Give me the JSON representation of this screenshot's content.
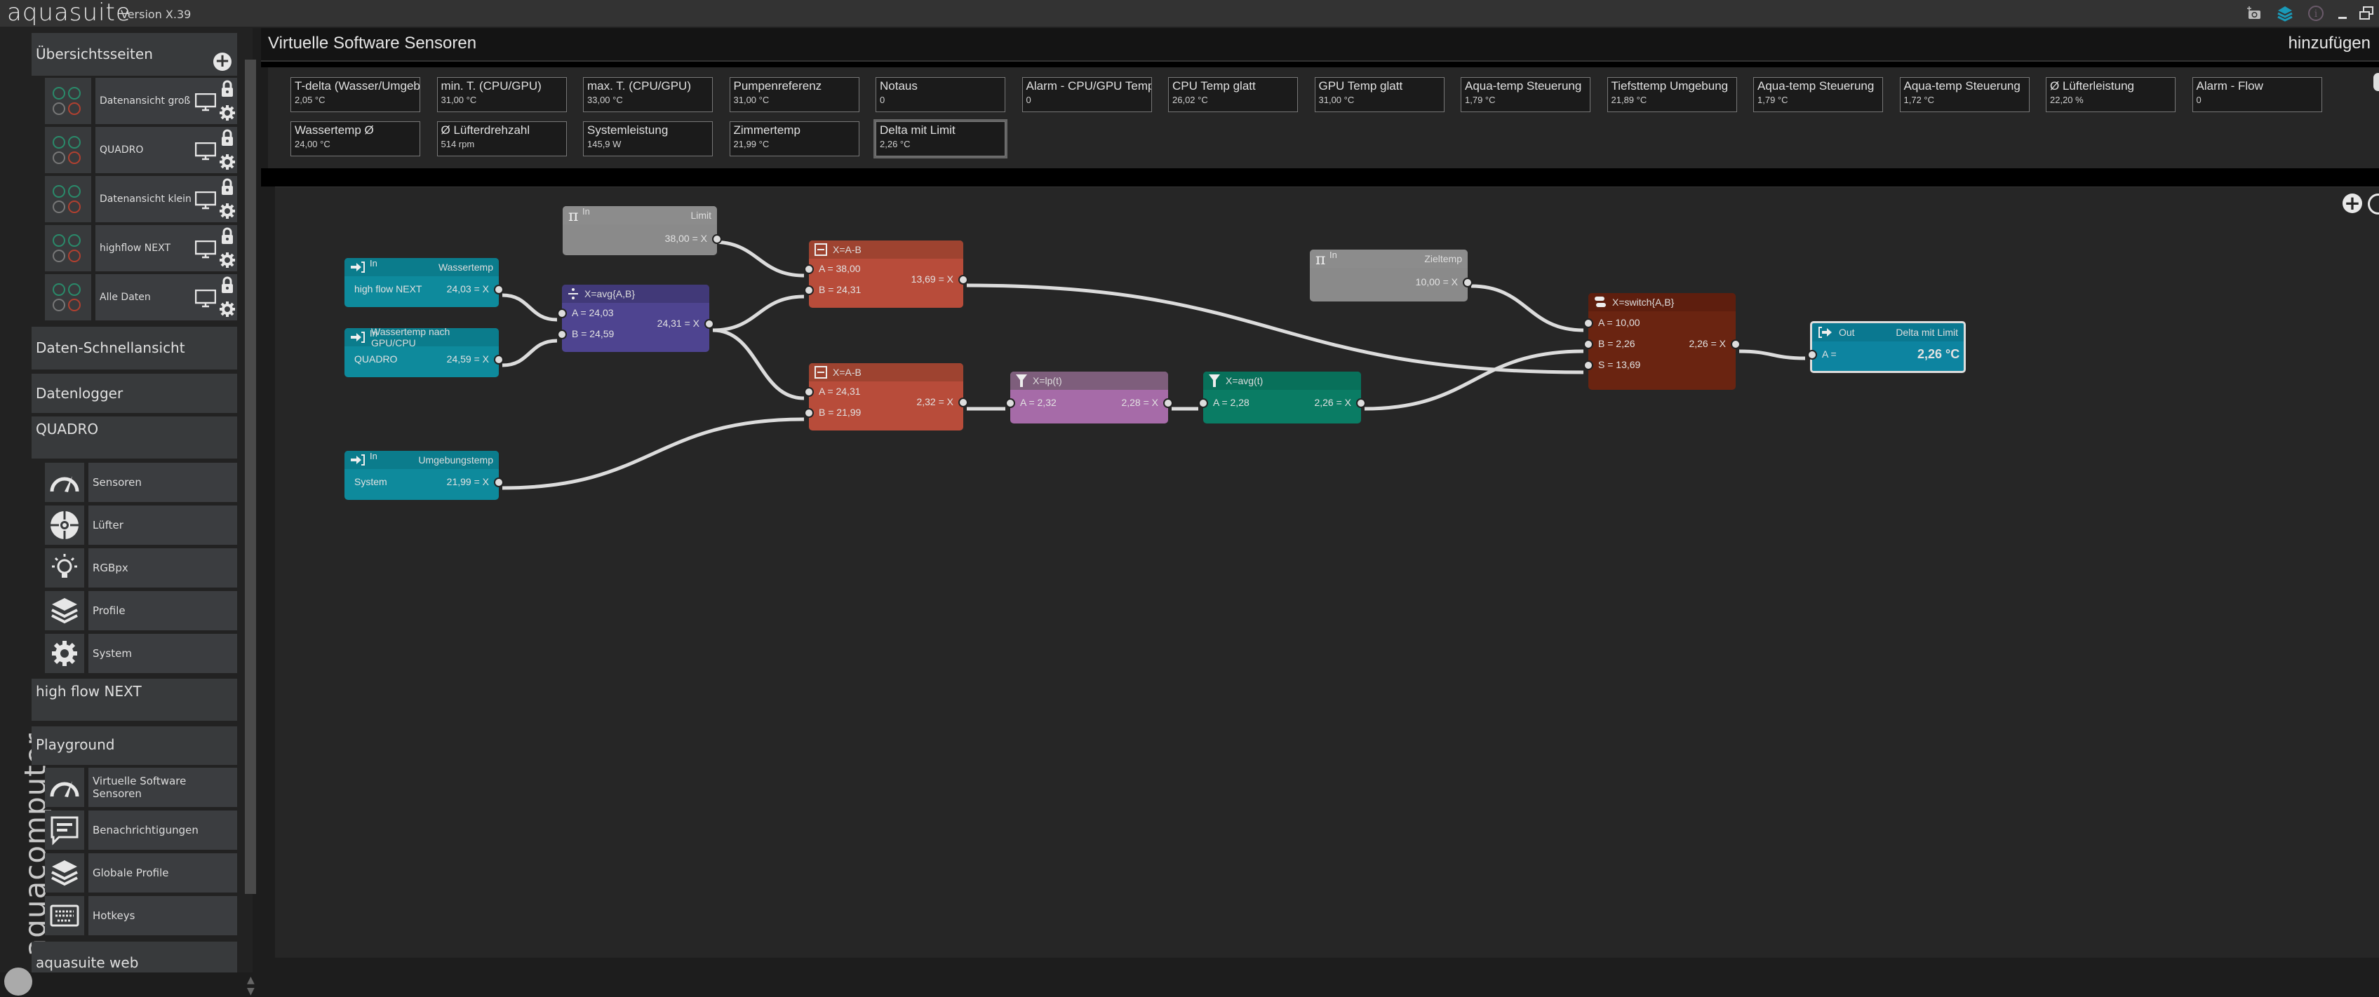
{
  "app": {
    "name": "aquasuite",
    "version": "Version X.39"
  },
  "window_controls": [
    {
      "name": "screenshot-icon"
    },
    {
      "name": "layers-icon"
    },
    {
      "name": "info-icon"
    },
    {
      "name": "minimize-icon"
    },
    {
      "name": "restore-icon"
    }
  ],
  "sidebar": {
    "overview_section": "Übersichtsseiten",
    "overview_pages": [
      {
        "label": "Datenansicht groß"
      },
      {
        "label": "QUADRO"
      },
      {
        "label": "Datenansicht klein"
      },
      {
        "label": "highflow NEXT"
      },
      {
        "label": "Alle Daten"
      }
    ],
    "quick_view": "Daten-Schnellansicht",
    "datalogger": "Datenlogger",
    "quadro_section": "QUADRO",
    "quadro_items": [
      {
        "label": "Sensoren",
        "icon": "gauge-icon"
      },
      {
        "label": "Lüfter",
        "icon": "fan-icon"
      },
      {
        "label": "RGBpx",
        "icon": "lightbulb-icon"
      },
      {
        "label": "Profile",
        "icon": "layers-icon"
      },
      {
        "label": "System",
        "icon": "gear-icon"
      }
    ],
    "highflow_section": "high flow NEXT",
    "playground_section": "Playground",
    "playground_items": [
      {
        "label": "Virtuelle Software Sensoren",
        "icon": "gauge-icon"
      },
      {
        "label": "Benachrichtigungen",
        "icon": "message-icon"
      },
      {
        "label": "Globale Profile",
        "icon": "layers-icon"
      },
      {
        "label": "Hotkeys",
        "icon": "keyboard-icon"
      }
    ],
    "web_section": "aquasuite web",
    "brand_vertical": "aquacomputer"
  },
  "header": {
    "title": "Virtuelle Software Sensoren",
    "add_label": "hinzufügen"
  },
  "tiles": [
    {
      "name": "T-delta (Wasser/Umgebung)",
      "value": "2,05 °C"
    },
    {
      "name": "min. T. (CPU/GPU)",
      "value": "31,00 °C"
    },
    {
      "name": "max. T. (CPU/GPU)",
      "value": "33,00 °C"
    },
    {
      "name": "Pumpenreferenz",
      "value": "31,00 °C"
    },
    {
      "name": "Notaus",
      "value": "0"
    },
    {
      "name": "Alarm - CPU/GPU Temp",
      "value": "0"
    },
    {
      "name": "CPU Temp glatt",
      "value": "26,02 °C"
    },
    {
      "name": "GPU Temp glatt",
      "value": "31,00 °C"
    },
    {
      "name": "Aqua-temp Steuerung",
      "value": "1,79 °C"
    },
    {
      "name": "Tiefsttemp Umgebung",
      "value": "21,89 °C"
    },
    {
      "name": "Aqua-temp Steuerung",
      "value": "1,79 °C"
    },
    {
      "name": "Aqua-temp Steuerung",
      "value": "1,72 °C"
    },
    {
      "name": "Ø Lüfterleistung",
      "value": "22,20 %"
    },
    {
      "name": "Alarm - Flow",
      "value": "0"
    },
    {
      "name": "Wassertemp Ø",
      "value": "24,00 °C"
    },
    {
      "name": "Ø Lüfterdrehzahl",
      "value": "514 rpm"
    },
    {
      "name": "Systemleistung",
      "value": "145,9 W"
    },
    {
      "name": "Zimmertemp",
      "value": "21,99 °C"
    },
    {
      "name": "Delta mit Limit",
      "value": "2,26 °C",
      "selected": true
    }
  ],
  "nodes": {
    "limit": {
      "type": "In",
      "name": "Limit",
      "out": "38,00 = X"
    },
    "wassertemp": {
      "type": "In",
      "name": "Wassertemp",
      "source": "high flow NEXT",
      "out": "24,03 = X"
    },
    "wassertemp_gpu": {
      "type": "In",
      "name": "Wassertemp nach GPU/CPU",
      "source": "QUADRO",
      "out": "24,59 = X"
    },
    "avg": {
      "formula": "X=avg{A,B}",
      "a": "A = 24,03",
      "b": "B = 24,59",
      "out": "24,31 = X"
    },
    "sub1": {
      "formula": "X=A-B",
      "a": "A = 38,00",
      "b": "B = 24,31",
      "out": "13,69 = X"
    },
    "sub2": {
      "formula": "X=A-B",
      "a": "A = 24,31",
      "b": "B = 21,99",
      "out": "2,32 = X"
    },
    "umgebung": {
      "type": "In",
      "name": "Umgebungstemp",
      "source": "System",
      "out": "21,99 = X"
    },
    "lp": {
      "formula": "X=lp(t)",
      "a": "A = 2,32",
      "out": "2,28 = X"
    },
    "avgt": {
      "formula": "X=avg(t)",
      "a": "A = 2,28",
      "out": "2,26 = X"
    },
    "zieltemp": {
      "type": "In",
      "name": "Zieltemp",
      "out": "10,00 = X"
    },
    "switch": {
      "formula": "X=switch{A,B}",
      "a": "A = 10,00",
      "b": "B = 2,26",
      "s": "S = 13,69",
      "out": "2,26 = X"
    },
    "output": {
      "type": "Out",
      "name": "Delta mit Limit",
      "a": "A =",
      "value": "2,26 °C"
    }
  },
  "colors": {
    "input_node": "#0e8a9c",
    "const_node": "#8a8a8a",
    "avg_node": "#4e4490",
    "sub_node": "#b84c3a",
    "lp_node": "#a66ba8",
    "avgt_node": "#0a7c64",
    "switch_node": "#6a2411",
    "out_node": "#0d84a0",
    "wire": "#dcdcdc"
  }
}
